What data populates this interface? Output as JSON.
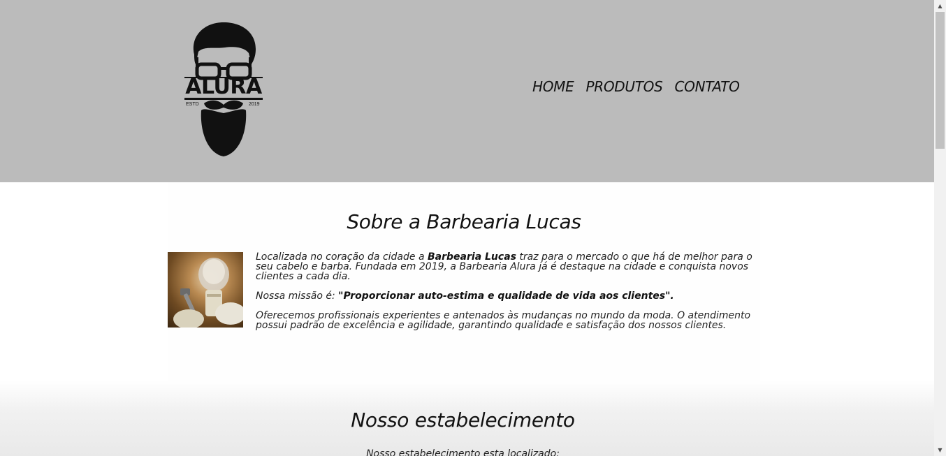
{
  "header": {
    "logo": {
      "text": "ALURA",
      "estd": "ESTD",
      "year": "2019"
    },
    "nav": [
      {
        "label": "HOME"
      },
      {
        "label": "PRODUTOS"
      },
      {
        "label": "CONTATO"
      }
    ]
  },
  "about": {
    "title": "Sobre a Barbearia Lucas",
    "image_icon": "shaving-brush-razor-image",
    "p1_before": "Localizada no coração da cidade a ",
    "p1_bold": "Barbearia Lucas",
    "p1_after": " traz para o mercado o que há de melhor para o seu cabelo e barba. Fundada em 2019, a Barbearia Alura já é destaque na cidade e conquista novos clientes a cada dia.",
    "p2_before": "Nossa missão é: ",
    "p2_bold": "\"Proporcionar auto-estima e qualidade de vida aos clientes\".",
    "p3": "Oferecemos profissionais experientes e antenados às mudanças no mundo da moda. O atendimento possui padrão de excelência e agilidade, garantindo qualidade e satisfação dos nossos clientes."
  },
  "establishment": {
    "title": "Nosso estabelecimento",
    "subtitle": "Nosso estabelecimento esta localizado:"
  },
  "colors": {
    "header_bg": "#bbbbbb",
    "text": "#111111"
  }
}
